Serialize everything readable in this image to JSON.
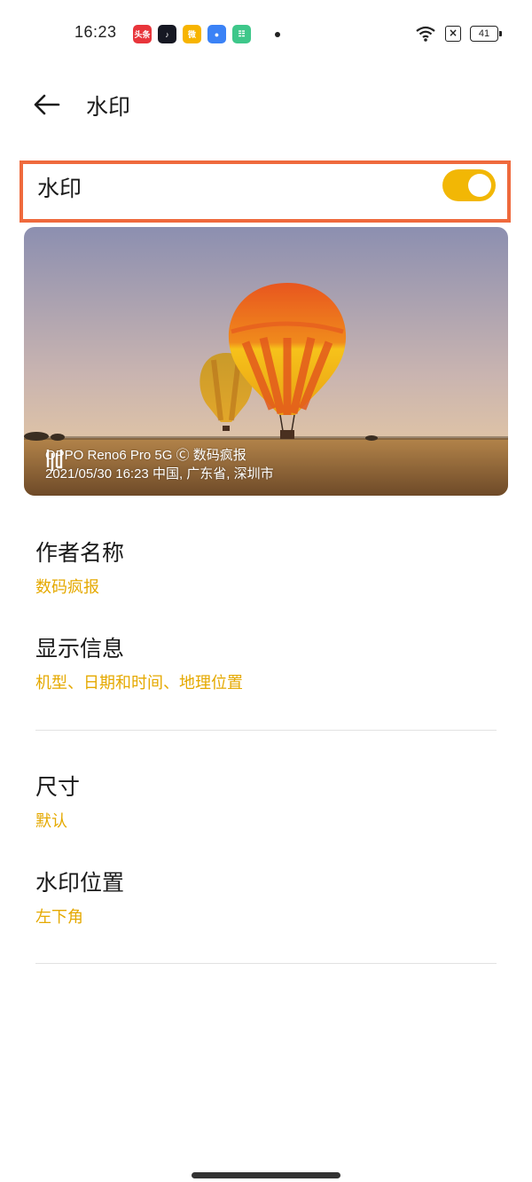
{
  "status_bar": {
    "time": "16:23",
    "apps": [
      {
        "name": "toutiao-icon",
        "label": "头条",
        "color": "#e8353b"
      },
      {
        "name": "douyin-icon",
        "label": "♪",
        "color": "#161823"
      },
      {
        "name": "weibo-icon",
        "label": "微",
        "color": "#f7b400"
      },
      {
        "name": "chat-icon",
        "label": "●",
        "color": "#3b82f6"
      },
      {
        "name": "green-app-icon",
        "label": "☷",
        "color": "#3ec78a"
      }
    ],
    "battery": "41"
  },
  "header": {
    "title": "水印"
  },
  "watermark_toggle": {
    "label": "水印",
    "on": true,
    "accent": "#f2b705",
    "highlight": "#ef6a3d"
  },
  "preview": {
    "line1": "OPPO Reno6 Pro 5G Ⓒ 数码疯报",
    "line2": "2021/05/30 16:23 中国, 广东省, 深圳市"
  },
  "settings": [
    {
      "title": "作者名称",
      "value": "数码疯报"
    },
    {
      "title": "显示信息",
      "value": "机型、日期和时间、地理位置"
    },
    {
      "title": "尺寸",
      "value": "默认"
    },
    {
      "title": "水印位置",
      "value": "左下角"
    }
  ],
  "colors": {
    "value_text": "#e5a900"
  }
}
